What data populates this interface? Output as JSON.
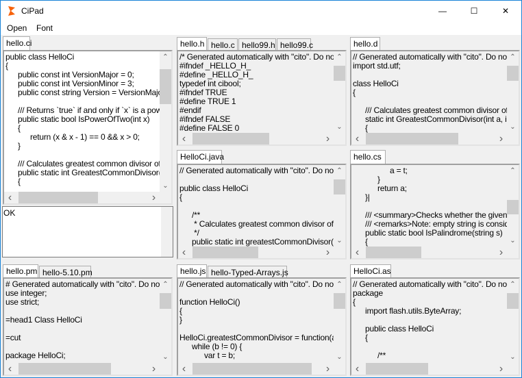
{
  "window": {
    "title": "CiPad",
    "accent": "#1883d7",
    "logo_color": "#f7630c",
    "controls": [
      {
        "name": "minimize-button",
        "icon": "minimize-icon",
        "glyph": "—"
      },
      {
        "name": "maximize-button",
        "icon": "maximize-icon",
        "glyph": "☐"
      },
      {
        "name": "close-button",
        "icon": "close-icon",
        "glyph": "✕"
      }
    ]
  },
  "menu": [
    "Open",
    "Font"
  ],
  "output": {
    "text": "OK"
  },
  "panels": [
    {
      "tabs": [
        "hello.ci"
      ],
      "active": 0,
      "white": true,
      "lines": [
        "public class HelloCi",
        "{",
        "\tpublic const int VersionMajor = 0;",
        "\tpublic const int VersionMinor = 3;",
        "\tpublic const string Version = VersionMajor + ",
        "",
        "\t/// Returns `true` if and only if `x` is a power",
        "\tpublic static bool IsPowerOfTwo(int x)",
        "\t{",
        "\t\treturn (x & x - 1) == 0 && x > 0;",
        "\t}",
        "",
        "\t/// Calculates greatest common divisor of `a",
        "\tpublic static int GreatestCommonDivisor(int a",
        "\t{"
      ]
    },
    {
      "tabs": [
        "hello.h",
        "hello.c",
        "hello99.h",
        "hello99.c"
      ],
      "active": 0,
      "lines": [
        "/* Generated automatically with \"cito\". Do not e",
        "#ifndef _HELLO_H_",
        "#define _HELLO_H_",
        "typedef int cibool;",
        "#ifndef TRUE",
        "#define TRUE 1",
        "#endif",
        "#ifndef FALSE",
        "#define FALSE 0"
      ]
    },
    {
      "tabs": [
        "hello.d"
      ],
      "active": 0,
      "lines": [
        "// Generated automatically with \"cito\". Do not e",
        "import std.utf;",
        "",
        "class HelloCi",
        "{",
        "",
        "\t/// Calculates greatest common divisor of a",
        "\tstatic int GreatestCommonDivisor(int a, int b",
        "\t{"
      ]
    },
    {
      "tabs": [
        "HelloCi.java"
      ],
      "active": 0,
      "lines": [
        "// Generated automatically with \"cito\". Do not e",
        "",
        "public class HelloCi",
        "{",
        "",
        "\t/**",
        "\t * Calculates greatest common divisor of <co",
        "\t */",
        "\tpublic static int greatestCommonDivisor(int a"
      ]
    },
    {
      "tabs": [
        "hello.cs"
      ],
      "active": 0,
      "lines": [
        "\t\t\ta = t;",
        "\t\t}",
        "\t\treturn a;",
        "\t}|",
        "",
        "\t/// <summary>Checks whether the given st",
        "\t/// <remarks>Note: empty string is consider",
        "\tpublic static bool IsPalindrome(string s)",
        "\t{"
      ]
    },
    {
      "tabs": [
        "hello.pm",
        "hello-5.10.pm"
      ],
      "active": 0,
      "lines": [
        "# Generated automatically with \"cito\". Do not e",
        "use integer;",
        "use strict;",
        "",
        "=head1 Class HelloCi",
        "",
        "=cut",
        "",
        "package HelloCi;"
      ]
    },
    {
      "tabs": [
        "hello.js",
        "hello-Typed-Arrays.js"
      ],
      "active": 0,
      "lines": [
        "// Generated automatically with \"cito\". Do not e",
        "",
        "function HelloCi()",
        "{",
        "}",
        "",
        "HelloCi.greatestCommonDivisor = function(a, b)",
        "\twhile (b != 0) {",
        "\t\tvar t = b;"
      ]
    },
    {
      "tabs": [
        "HelloCi.as"
      ],
      "active": 0,
      "lines": [
        "// Generated automatically with \"cito\". Do not e",
        "package",
        "{",
        "\timport flash.utils.ByteArray;",
        "",
        "\tpublic class HelloCi",
        "\t{",
        "",
        "\t\t/**"
      ]
    }
  ]
}
